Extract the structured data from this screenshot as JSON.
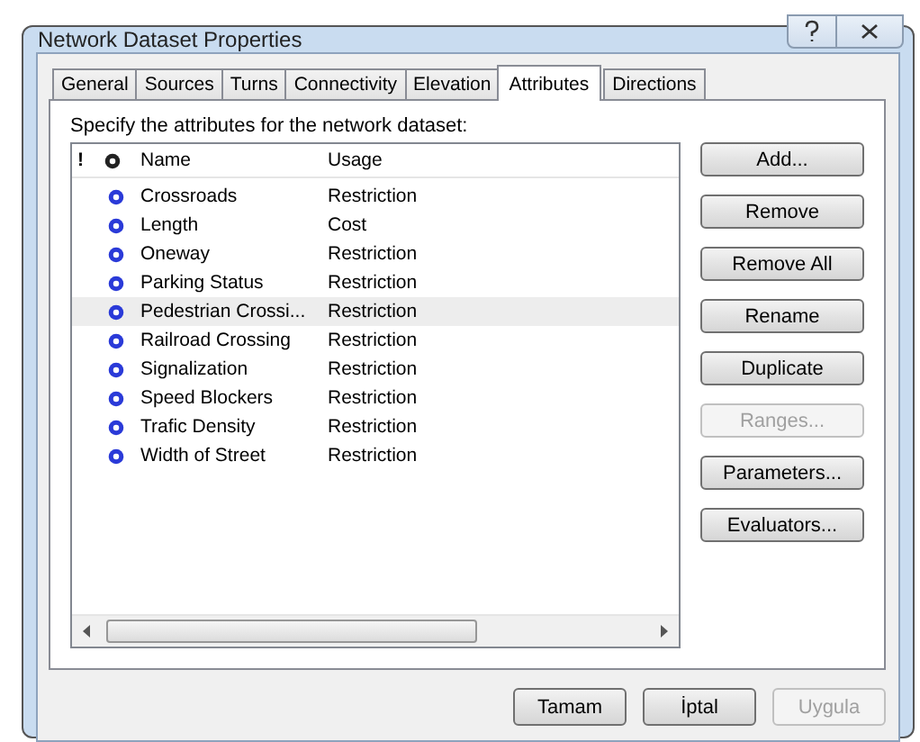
{
  "window": {
    "title": "Network Dataset Properties"
  },
  "tabs": [
    {
      "label": "General",
      "selected": false
    },
    {
      "label": "Sources",
      "selected": false
    },
    {
      "label": "Turns",
      "selected": false
    },
    {
      "label": "Connectivity",
      "selected": false
    },
    {
      "label": "Elevation",
      "selected": false
    },
    {
      "label": "Attributes",
      "selected": true
    },
    {
      "label": "Directions",
      "selected": false
    }
  ],
  "instruction": "Specify the attributes for the network dataset:",
  "table": {
    "columns": [
      "!",
      "",
      "Name",
      "Usage"
    ],
    "rows": [
      {
        "name": "Crossroads",
        "usage": "Restriction",
        "selected": false
      },
      {
        "name": "Length",
        "usage": "Cost",
        "selected": false
      },
      {
        "name": "Oneway",
        "usage": "Restriction",
        "selected": false
      },
      {
        "name": "Parking Status",
        "usage": "Restriction",
        "selected": false
      },
      {
        "name": "Pedestrian Crossi...",
        "usage": "Restriction",
        "selected": true
      },
      {
        "name": "Railroad Crossing",
        "usage": "Restriction",
        "selected": false
      },
      {
        "name": "Signalization",
        "usage": "Restriction",
        "selected": false
      },
      {
        "name": "Speed Blockers",
        "usage": "Restriction",
        "selected": false
      },
      {
        "name": "Trafic Density",
        "usage": "Restriction",
        "selected": false
      },
      {
        "name": "Width of Street",
        "usage": "Restriction",
        "selected": false
      }
    ]
  },
  "side_buttons": [
    {
      "label": "Add...",
      "disabled": false
    },
    {
      "label": "Remove",
      "disabled": false
    },
    {
      "label": "Remove All",
      "disabled": false
    },
    {
      "label": "Rename",
      "disabled": false
    },
    {
      "label": "Duplicate",
      "disabled": false
    },
    {
      "label": "Ranges...",
      "disabled": true
    },
    {
      "label": "Parameters...",
      "disabled": false
    },
    {
      "label": "Evaluators...",
      "disabled": false
    }
  ],
  "footer_buttons": [
    {
      "label": "Tamam",
      "disabled": false
    },
    {
      "label": "İptal",
      "disabled": false
    },
    {
      "label": "Uygula",
      "disabled": true
    }
  ]
}
